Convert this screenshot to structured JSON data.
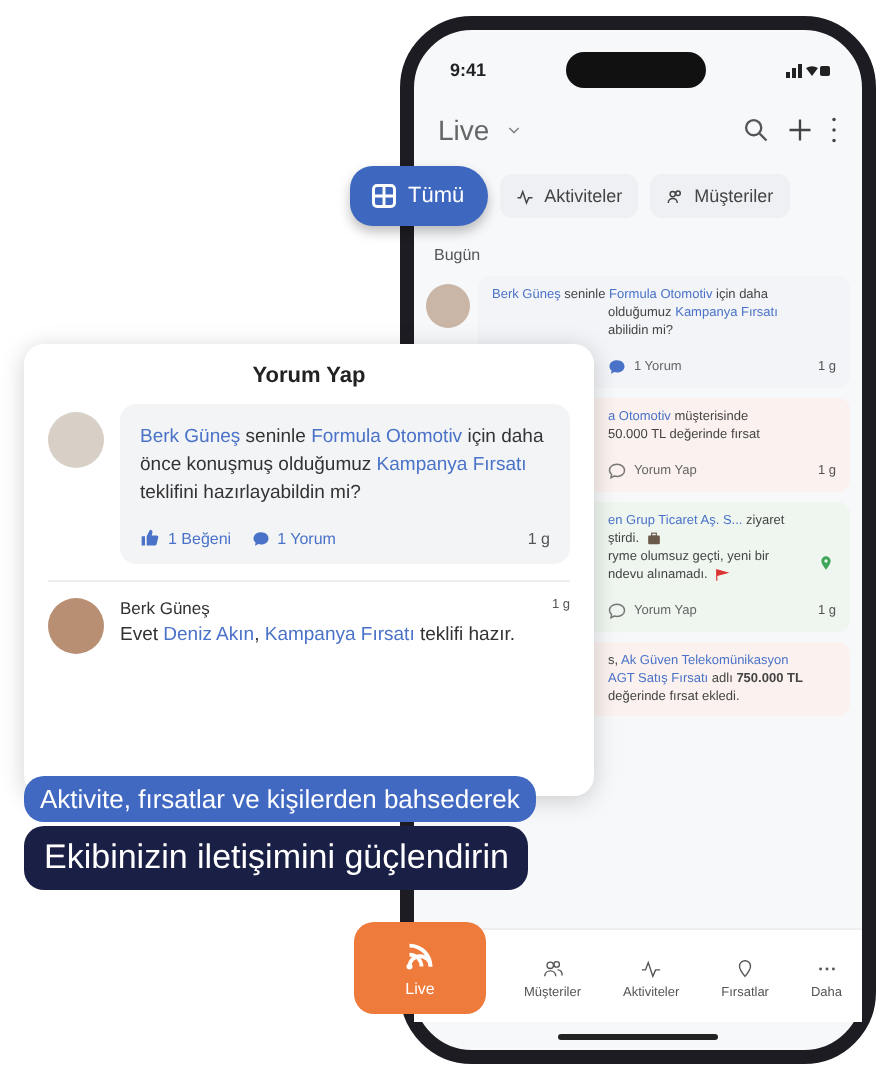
{
  "phone": {
    "status_time": "9:41",
    "header_title": "Live",
    "tabs": [
      {
        "label": "Tümü",
        "selected": true
      },
      {
        "label": "Aktiviteler",
        "selected": false
      },
      {
        "label": "Müşteriler",
        "selected": false
      }
    ],
    "section_title": "Bugün",
    "feed": [
      {
        "kind": "comment",
        "color": "#f3f4f7",
        "lines": [
          [
            {
              "t": "Berk Güneş",
              "link": true
            },
            {
              "t": " seninle ",
              "link": false
            },
            {
              "t": "Formula Otomotiv",
              "link": true
            },
            {
              "t": " için daha",
              "link": false
            }
          ],
          [
            {
              "t": "olduğumuz ",
              "link": false
            },
            {
              "t": "Kampanya Fırsatı",
              "link": true
            }
          ],
          [
            {
              "t": "abilidin mi?",
              "link": false
            }
          ]
        ],
        "action": "1 Yorum",
        "time": "1 g"
      },
      {
        "kind": "deal",
        "color": "#fbf1ef",
        "lines": [
          [
            {
              "t": "a Otomotiv",
              "link": true
            },
            {
              "t": " müşterisinde",
              "link": false
            }
          ],
          [
            {
              "t": "50.000 TL değerinde fırsat",
              "link": false
            }
          ]
        ],
        "action": "Yorum Yap",
        "time": "1 g"
      },
      {
        "kind": "visit",
        "color": "#eef6ef",
        "lines": [
          [
            {
              "t": "en Grup Ticaret Aş. S...",
              "link": true
            },
            {
              "t": " ziyaret",
              "link": false
            }
          ],
          [
            {
              "t": "ştirdi.",
              "link": false
            }
          ],
          [
            {
              "t": "ryme olumsuz geçti, yeni bir",
              "link": false
            }
          ],
          [
            {
              "t": "ndevu alınamadı.",
              "link": false
            }
          ]
        ],
        "action": "Yorum Yap",
        "time": "1 g"
      },
      {
        "kind": "deal",
        "color": "#fbf1ef",
        "lines": [
          [
            {
              "t": "s, ",
              "link": false
            },
            {
              "t": "Ak Güven Telekomünikasyon",
              "link": true
            }
          ],
          [
            {
              "t": "AGT Satış Fırsatı",
              "link": true
            },
            {
              "t": " adlı **750.000 TL**",
              "link": false
            }
          ],
          [
            {
              "t": "değerinde fırsat ekledi.",
              "link": false
            }
          ]
        ]
      }
    ],
    "nav": [
      {
        "label": "Live",
        "selected": true
      },
      {
        "label": "Müşteriler",
        "selected": false
      },
      {
        "label": "Aktiviteler",
        "selected": false
      },
      {
        "label": "Fırsatlar",
        "selected": false
      },
      {
        "label": "Daha",
        "selected": false
      }
    ]
  },
  "comment_card": {
    "title": "Yorum Yap",
    "post": {
      "segments": [
        {
          "t": "Berk Güneş",
          "link": true
        },
        {
          "t": " seninle ",
          "link": false
        },
        {
          "t": "Formula Otomotiv",
          "link": true
        },
        {
          "t": " için daha önce konuşmuş olduğumuz ",
          "link": false
        },
        {
          "t": "Kampanya Fırsatı",
          "link": true
        },
        {
          "t": " teklifini hazırlayabildin mi?",
          "link": false
        }
      ],
      "likes": "1 Beğeni",
      "comments": "1 Yorum",
      "time": "1 g"
    },
    "reply": {
      "author": "Berk Güneş",
      "time": "1 g",
      "segments": [
        {
          "t": "Evet ",
          "link": false
        },
        {
          "t": "Deniz Akın",
          "link": true
        },
        {
          "t": ", ",
          "link": false
        },
        {
          "t": "Kampanya Fırsatı",
          "link": true
        },
        {
          "t": " teklifi hazır.",
          "link": false
        }
      ]
    }
  },
  "banners": [
    "Aktivite, fırsatlar ve kişilerden bahsederek",
    "Ekibinizin iletişimini güçlendirin"
  ]
}
